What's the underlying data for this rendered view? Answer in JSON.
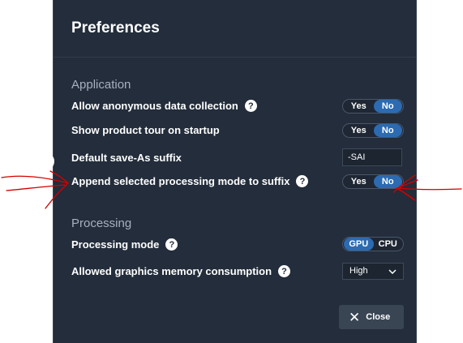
{
  "dialog": {
    "title": "Preferences",
    "close_label": "Close"
  },
  "application": {
    "heading": "Application",
    "rows": [
      {
        "label": "Allow anonymous data collection",
        "options": [
          "Yes",
          "No"
        ],
        "selected": "No"
      },
      {
        "label": "Show product tour on startup",
        "options": [
          "Yes",
          "No"
        ],
        "selected": "No"
      },
      {
        "label": "Default save-As suffix",
        "value": "-SAI"
      },
      {
        "label": "Append selected processing mode to suffix",
        "options": [
          "Yes",
          "No"
        ],
        "selected": "No"
      }
    ]
  },
  "processing": {
    "heading": "Processing",
    "mode": {
      "label": "Processing mode",
      "options": [
        "GPU",
        "CPU"
      ],
      "selected": "GPU"
    },
    "memory": {
      "label": "Allowed graphics memory consumption",
      "value": "High"
    }
  },
  "icons": {
    "help": "?",
    "chevron": "chevron-down-icon",
    "close": "close-icon"
  },
  "colors": {
    "panel_bg": "#232d3b",
    "accent": "#2c6bb1",
    "annotation": "#d40000"
  }
}
